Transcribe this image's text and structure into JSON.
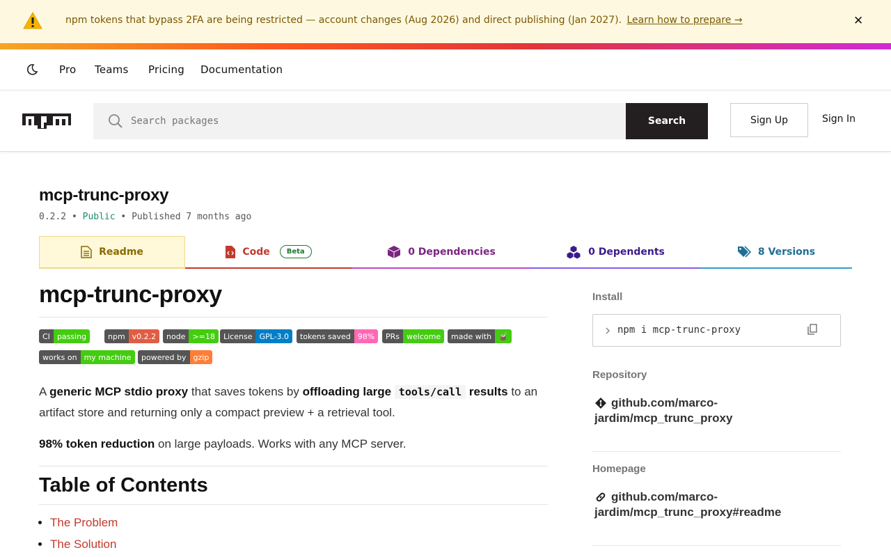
{
  "banner": {
    "icon": "warning-icon",
    "message": "npm tokens that bypass 2FA are being restricted — account changes (Aug 2026) and direct publishing (Jan 2027).",
    "link": "Learn how to prepare →",
    "close": "✕"
  },
  "topnav": {
    "theme_icon": "moon-icon",
    "links": [
      "Pro",
      "Teams",
      "Pricing",
      "Documentation"
    ]
  },
  "header": {
    "logo": "npm",
    "search_placeholder": "Search packages",
    "search_button": "Search",
    "sign_up": "Sign Up",
    "sign_in": "Sign In"
  },
  "package": {
    "name": "mcp-trunc-proxy",
    "version": "0.2.2",
    "visibility": "Public",
    "published": "Published 7 months ago",
    "separator": "•"
  },
  "tabs": {
    "readme": "Readme",
    "code": "Code",
    "code_badge": "Beta",
    "dependencies": "0 Dependencies",
    "dependents": "0 Dependents",
    "versions": "8 Versions"
  },
  "readme": {
    "title": "mcp-trunc-proxy",
    "badges": [
      {
        "label": "CI",
        "value": "passing",
        "color": "#4c1"
      },
      {
        "label": "npm",
        "value": "v0.2.2",
        "color": "#e05d44"
      },
      {
        "label": "node",
        "value": ">=18",
        "color": "#4c1"
      },
      {
        "label": "License",
        "value": "GPL-3.0",
        "color": "#007ec6"
      },
      {
        "label": "tokens saved",
        "value": "98%",
        "color": "#ff69b4"
      },
      {
        "label": "PRs",
        "value": "welcome",
        "color": "#4c1"
      },
      {
        "label": "made with",
        "value": "🧉",
        "color": "#4c1"
      },
      {
        "label": "works on",
        "value": "my machine",
        "color": "#4c1"
      },
      {
        "label": "powered by",
        "value": "gzip",
        "color": "#fe7d37"
      }
    ],
    "p1": {
      "a": "A ",
      "b1": "generic MCP stdio proxy",
      "c": " that saves tokens by ",
      "b2": "offloading large ",
      "code": "tools/call",
      "b3": " results",
      "d": " to an artifact store and returning only a compact preview + a retrieval tool."
    },
    "p2": {
      "b": "98% token reduction",
      "rest": " on large payloads. Works with any MCP server."
    },
    "toc_title": "Table of Contents",
    "toc": [
      "The Problem",
      "The Solution"
    ]
  },
  "sidebar": {
    "install_label": "Install",
    "install_cmd": "npm i mcp-trunc-proxy",
    "repo_label": "Repository",
    "repo_link": "github.com/marco-jardim/mcp_trunc_proxy",
    "home_label": "Homepage",
    "home_link": "github.com/marco-jardim/mcp_trunc_proxy#readme"
  }
}
